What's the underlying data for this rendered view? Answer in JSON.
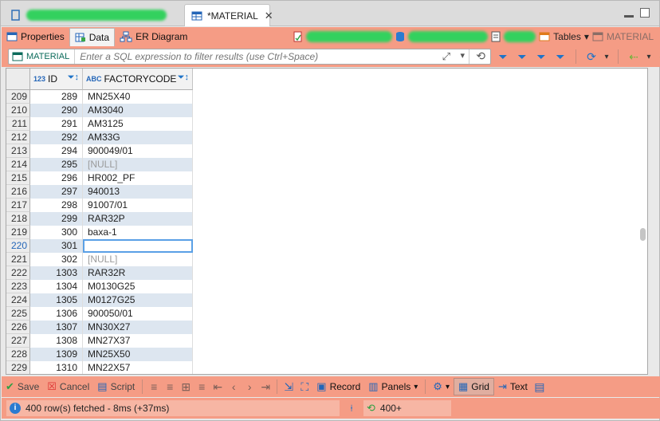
{
  "tabs": {
    "inactive_label": "",
    "active_label": "*MATERIAL"
  },
  "view_tabs": [
    {
      "label": "Properties",
      "icon": "properties-icon"
    },
    {
      "label": "Data",
      "icon": "data-grid-icon"
    },
    {
      "label": "ER Diagram",
      "icon": "er-diagram-icon"
    }
  ],
  "right_tools": {
    "tables_label": "Tables",
    "material_label": "MATERIAL"
  },
  "filter": {
    "table_name": "MATERIAL",
    "placeholder": "Enter a SQL expression to filter results (use Ctrl+Space)"
  },
  "grid": {
    "columns": [
      {
        "type_badge": "123",
        "name": "ID"
      },
      {
        "type_badge": "ABC",
        "name": "FACTORYCODE"
      }
    ],
    "rows": [
      {
        "n": "209",
        "id": "289",
        "code": "MN25X40"
      },
      {
        "n": "210",
        "id": "290",
        "code": "AM3040"
      },
      {
        "n": "211",
        "id": "291",
        "code": "AM3125"
      },
      {
        "n": "212",
        "id": "292",
        "code": "AM33G"
      },
      {
        "n": "213",
        "id": "294",
        "code": "900049/01"
      },
      {
        "n": "214",
        "id": "295",
        "code": "[NULL]"
      },
      {
        "n": "215",
        "id": "296",
        "code": "HR002_PF"
      },
      {
        "n": "216",
        "id": "297",
        "code": "940013"
      },
      {
        "n": "217",
        "id": "298",
        "code": "91007/01"
      },
      {
        "n": "218",
        "id": "299",
        "code": "RAR32P"
      },
      {
        "n": "219",
        "id": "300",
        "code": "baxa-1"
      },
      {
        "n": "220",
        "id": "301",
        "code": ""
      },
      {
        "n": "221",
        "id": "302",
        "code": "[NULL]"
      },
      {
        "n": "222",
        "id": "1303",
        "code": "RAR32R"
      },
      {
        "n": "223",
        "id": "1304",
        "code": "M0130G25"
      },
      {
        "n": "224",
        "id": "1305",
        "code": "M0127G25"
      },
      {
        "n": "225",
        "id": "1306",
        "code": "900050/01"
      },
      {
        "n": "226",
        "id": "1307",
        "code": "MN30X27"
      },
      {
        "n": "227",
        "id": "1308",
        "code": "MN27X37"
      },
      {
        "n": "228",
        "id": "1309",
        "code": "MN25X50"
      },
      {
        "n": "229",
        "id": "1310",
        "code": "MN22X57"
      }
    ]
  },
  "bottom_toolbar": {
    "save": "Save",
    "cancel": "Cancel",
    "script": "Script",
    "record": "Record",
    "panels": "Panels",
    "grid": "Grid",
    "text": "Text"
  },
  "status": {
    "message": "400 row(s) fetched - 8ms (+37ms)",
    "fetch_size": "400+"
  }
}
